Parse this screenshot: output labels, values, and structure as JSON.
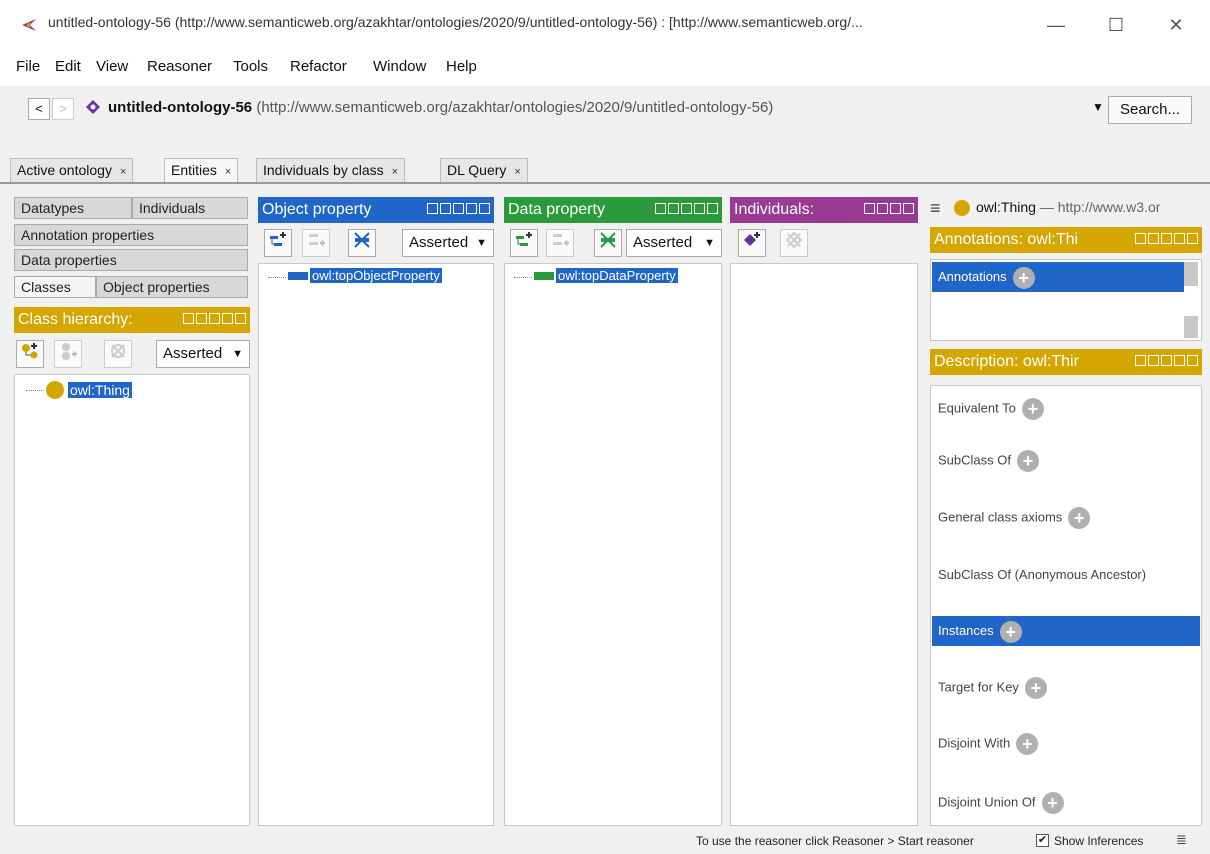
{
  "window": {
    "title": "untitled-ontology-56 (http://www.semanticweb.org/azakhtar/ontologies/2020/9/untitled-ontology-56) : [http://www.semanticweb.org/...",
    "minimize": "—",
    "maximize": "☐",
    "close": "✕"
  },
  "menu": [
    "File",
    "Edit",
    "View",
    "Reasoner",
    "Tools",
    "Refactor",
    "Window",
    "Help"
  ],
  "address": {
    "back": "<",
    "forward": ">",
    "ontology_name": "untitled-ontology-56",
    "ontology_iri": "(http://www.semanticweb.org/azakhtar/ontologies/2020/9/untitled-ontology-56)",
    "dropdown": "▼",
    "search_label": "Search..."
  },
  "tabs": [
    {
      "label": "Active ontology",
      "close": "×"
    },
    {
      "label": "Entities",
      "close": "×"
    },
    {
      "label": "Individuals by class",
      "close": "×"
    },
    {
      "label": "DL Query",
      "close": "×"
    }
  ],
  "left_tabs": {
    "datatypes": "Datatypes",
    "individuals": "Individuals",
    "annotation_properties": "Annotation properties",
    "data_properties": "Data properties",
    "classes": "Classes",
    "object_properties": "Object properties"
  },
  "class_hierarchy": {
    "header": "Class hierarchy:",
    "asserted": "Asserted",
    "root": "owl:Thing"
  },
  "object_property": {
    "header": "Object property",
    "asserted": "Asserted",
    "root": "owl:topObjectProperty"
  },
  "data_property": {
    "header": "Data property",
    "asserted": "Asserted",
    "root": "owl:topDataProperty"
  },
  "individuals": {
    "header": "Individuals:"
  },
  "entity": {
    "menu_icon": "≡",
    "name": "owl:Thing",
    "iri": "— http://www.w3.or"
  },
  "annotations": {
    "header": "Annotations: owl:Thi",
    "row_label": "Annotations"
  },
  "description": {
    "header": "Description: owl:Thir",
    "items": [
      {
        "label": "Equivalent To",
        "plus": true
      },
      {
        "label": "SubClass Of",
        "plus": true
      },
      {
        "label": "General class axioms",
        "plus": true
      },
      {
        "label": "SubClass Of (Anonymous Ancestor)",
        "plus": false
      },
      {
        "label": "Instances",
        "plus": true
      },
      {
        "label": "Target for Key",
        "plus": true
      },
      {
        "label": "Disjoint With",
        "plus": true
      },
      {
        "label": "Disjoint Union Of",
        "plus": true
      }
    ]
  },
  "status": {
    "text": "To use the reasoner click Reasoner > Start reasoner",
    "show_inferences": "Show Inferences",
    "show_inferences_checked": true,
    "check_mark": "✔",
    "menu_icon": "≣"
  },
  "colors": {
    "gold": "#d6a600",
    "blue": "#1f66c8",
    "green": "#2a9a3c",
    "purple": "#9a3b93"
  }
}
